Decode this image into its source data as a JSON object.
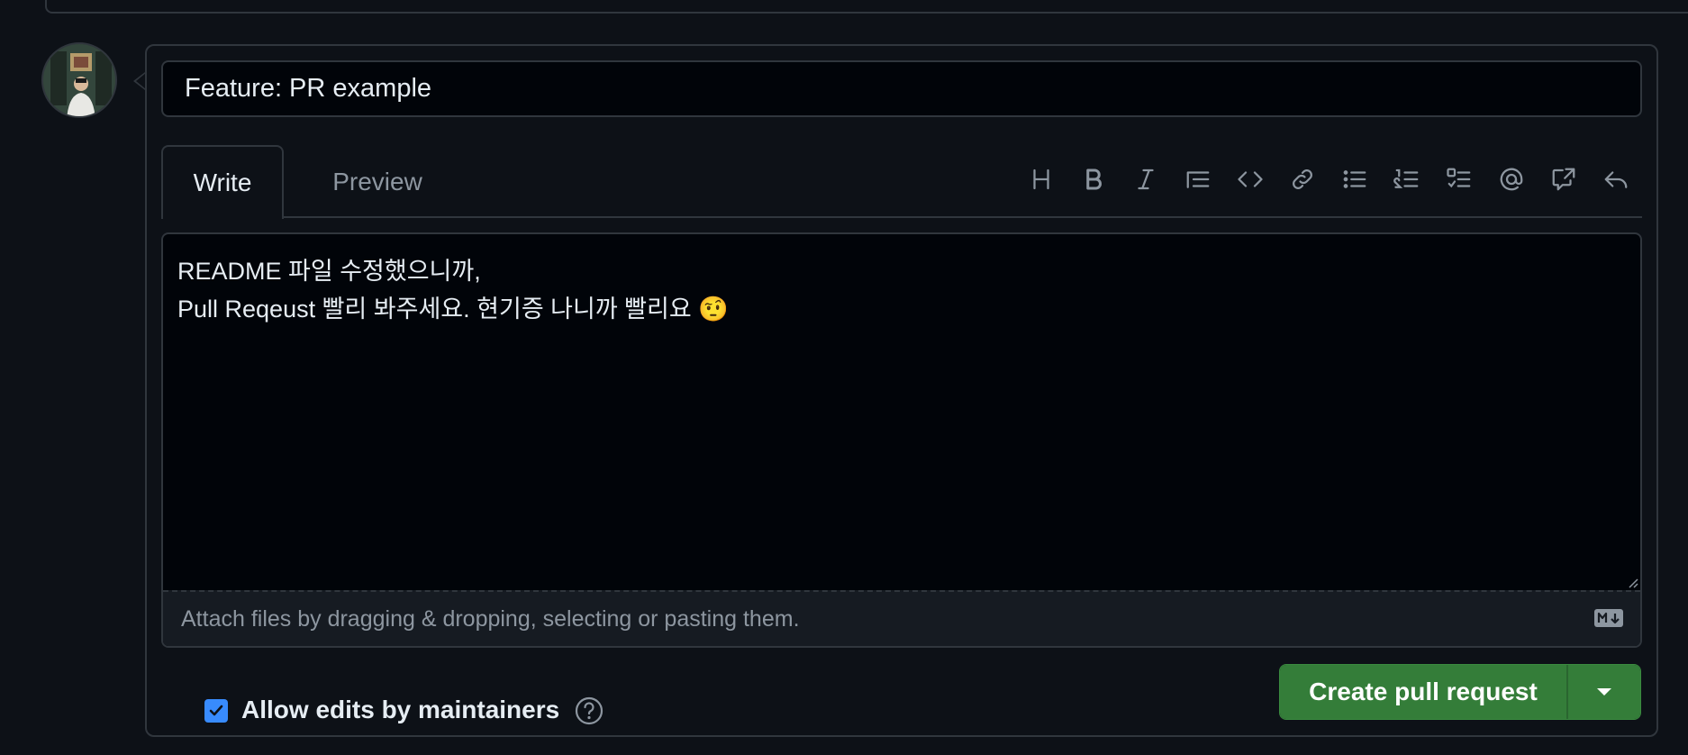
{
  "pr": {
    "title_value": "Feature: PR example"
  },
  "tabs": {
    "write": "Write",
    "preview": "Preview"
  },
  "toolbar": {
    "icons": [
      "heading-icon",
      "bold-icon",
      "italic-icon",
      "quote-icon",
      "code-icon",
      "link-icon",
      "bulleted-list-icon",
      "numbered-list-icon",
      "task-list-icon",
      "mention-icon",
      "reference-icon",
      "saved-reply-icon"
    ]
  },
  "editor": {
    "body_line1": "README 파일 수정했으니까,",
    "body_line2": "Pull Reqeust 빨리 봐주세요. 현기증 나니까 빨리요 🤨",
    "attach_hint": "Attach files by dragging & dropping, selecting or pasting them."
  },
  "options": {
    "allow_edits_label": "Allow edits by maintainers",
    "allow_edits_checked": true
  },
  "actions": {
    "create_label": "Create pull request"
  },
  "colors": {
    "background": "#0d1117",
    "border": "#30363d",
    "primary_button": "#347d39",
    "checkbox": "#388bfd"
  }
}
